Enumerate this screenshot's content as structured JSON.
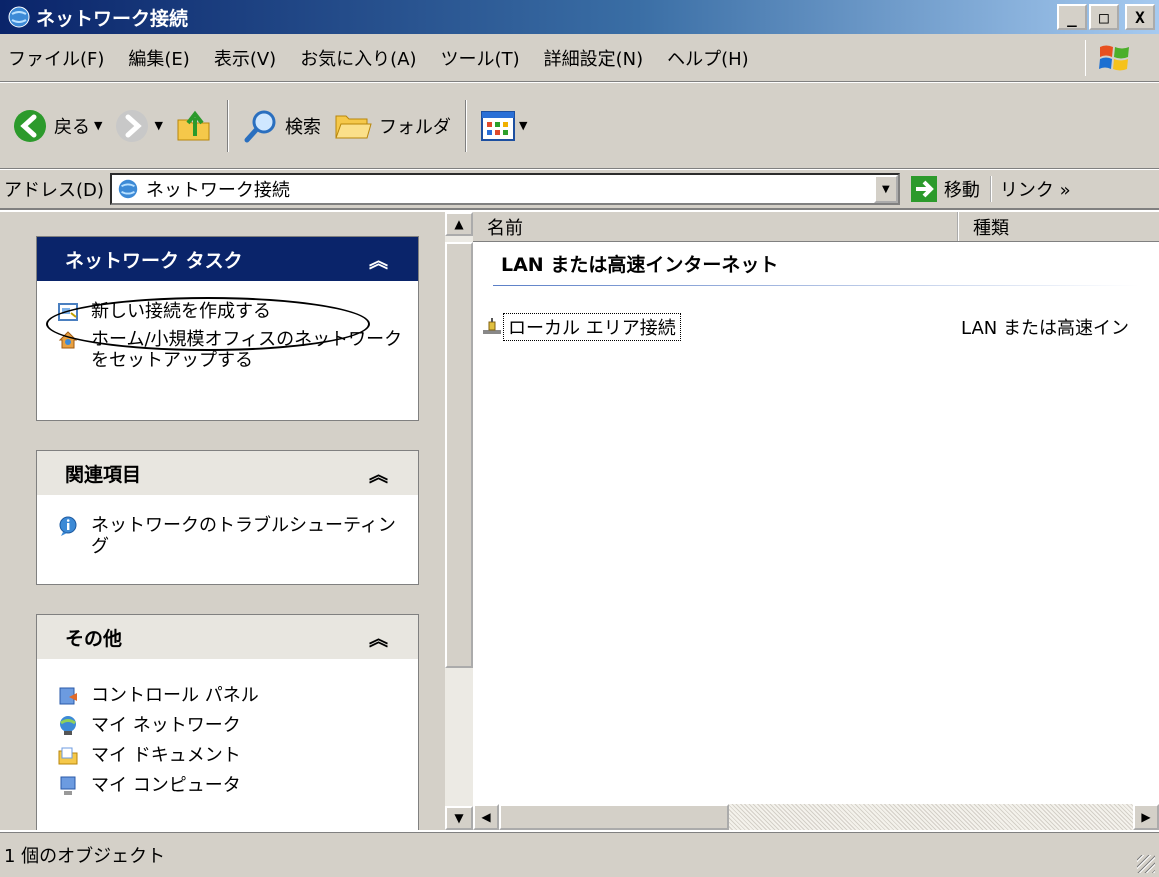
{
  "window": {
    "title": "ネットワーク接続",
    "min_label": "_",
    "max_label": "□",
    "close_label": "X"
  },
  "menu": [
    "ファイル(F)",
    "編集(E)",
    "表示(V)",
    "お気に入り(A)",
    "ツール(T)",
    "詳細設定(N)",
    "ヘルプ(H)"
  ],
  "toolbar": {
    "back_label": "戻る",
    "search_label": "検索",
    "folders_label": "フォルダ"
  },
  "address": {
    "label": "アドレス(D)",
    "value": "ネットワーク接続",
    "go_label": "移動",
    "links_label": "リンク »"
  },
  "tasks": {
    "network": {
      "title": "ネットワーク タスク",
      "items": [
        "新しい接続を作成する",
        "ホーム/小規模オフィスのネットワークをセットアップする"
      ]
    },
    "related": {
      "title": "関連項目",
      "items": [
        "ネットワークのトラブルシューティング"
      ]
    },
    "other": {
      "title": "その他",
      "items": [
        "コントロール パネル",
        "マイ ネットワーク",
        "マイ ドキュメント",
        "マイ コンピュータ"
      ]
    },
    "collapse_glyph": "︽"
  },
  "list": {
    "columns": [
      "名前",
      "種類"
    ],
    "group": "LAN または高速インターネット",
    "rows": [
      {
        "name": "ローカル エリア接続",
        "type": "LAN または高速イン"
      }
    ]
  },
  "status": "1 個のオブジェクト"
}
